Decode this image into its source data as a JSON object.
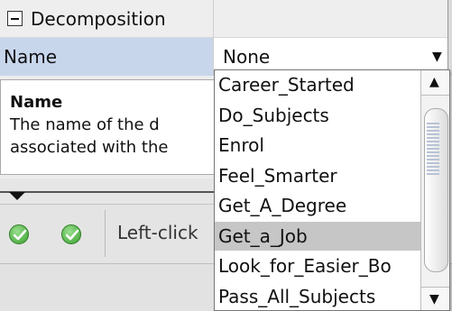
{
  "property_sheet": {
    "category_label": "Decomposition",
    "name_label": "Name",
    "name_value": "None"
  },
  "description": {
    "title": "Name",
    "line1": "The name of the d",
    "line2": "associated with the"
  },
  "status": {
    "text": "Left-click"
  },
  "dropdown": {
    "options": [
      "Career_Started",
      "Do_Subjects",
      "Enrol",
      "Feel_Smarter",
      "Get_A_Degree",
      "Get_a_Job",
      "Look_for_Easier_Bo",
      "Pass_All_Subjects"
    ],
    "highlighted": "Get_a_Job"
  },
  "icons": {
    "category_toggle": "collapse-minus-icon",
    "status": "green-check-icon",
    "combo_arrow": "chevron-down-icon"
  },
  "colors": {
    "selected_row": "#c8d6ec",
    "highlighted_option": "#c6c6c6",
    "status_ok": "#3a9f2f"
  }
}
